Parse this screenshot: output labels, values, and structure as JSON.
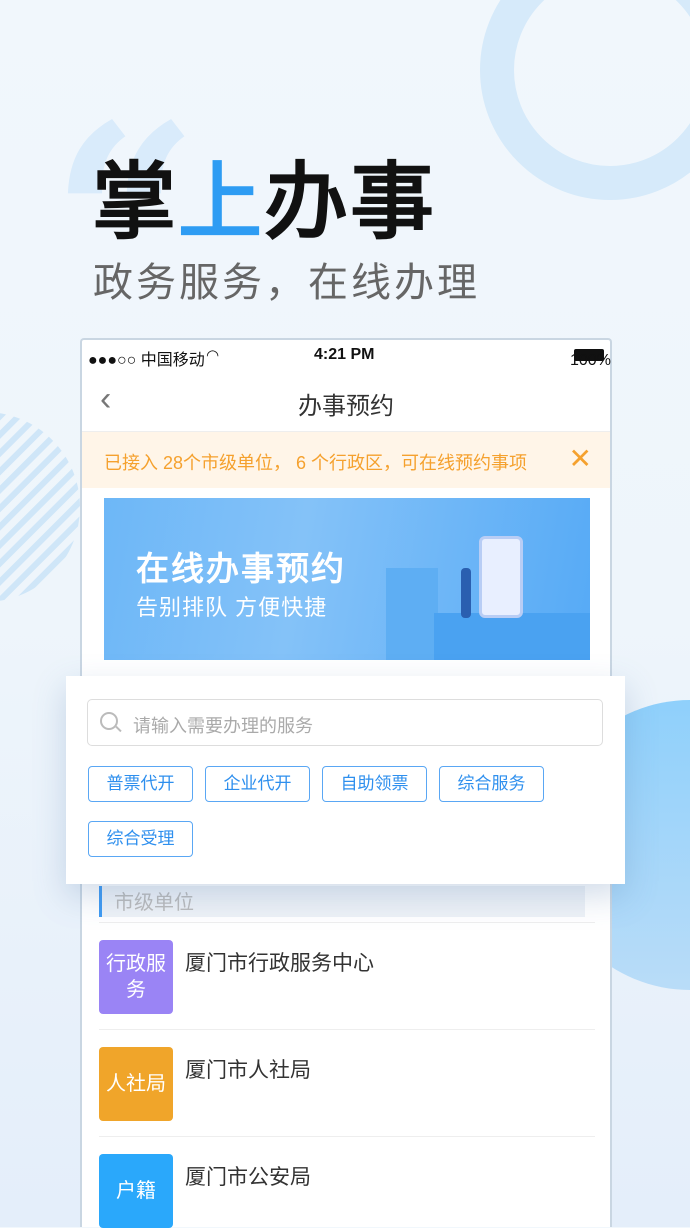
{
  "hero": {
    "title_a": "掌",
    "title_b": "上",
    "title_c": "办事",
    "subtitle": "政务服务，在线办理"
  },
  "status_bar": {
    "carrier": "●●●○○ 中国移动",
    "time": "4:21 PM",
    "battery": "100%"
  },
  "nav": {
    "title": "办事预约"
  },
  "notice": {
    "text": "已接入 28个市级单位， 6 个行政区，可在线预约事项",
    "close_icon": "close-icon"
  },
  "banner": {
    "title": "在线办事预约",
    "subtitle": "告别排队   方便快捷"
  },
  "search": {
    "placeholder": "请输入需要办理的服务"
  },
  "tags": [
    "普票代开",
    "企业代开",
    "自助领票",
    "综合服务",
    "综合受理"
  ],
  "section": {
    "label": "市级单位"
  },
  "units": [
    {
      "badge": "行政服务",
      "name": "厦门市行政服务中心",
      "color": "#9a84f5"
    },
    {
      "badge": "人社局",
      "name": "厦门市人社局",
      "color": "#f0a52a"
    },
    {
      "badge": "户籍",
      "name": "厦门市公安局",
      "color": "#2aa8fb"
    }
  ],
  "colors": {
    "accent": "#2e9cf3",
    "notice": "#f5a12e"
  }
}
